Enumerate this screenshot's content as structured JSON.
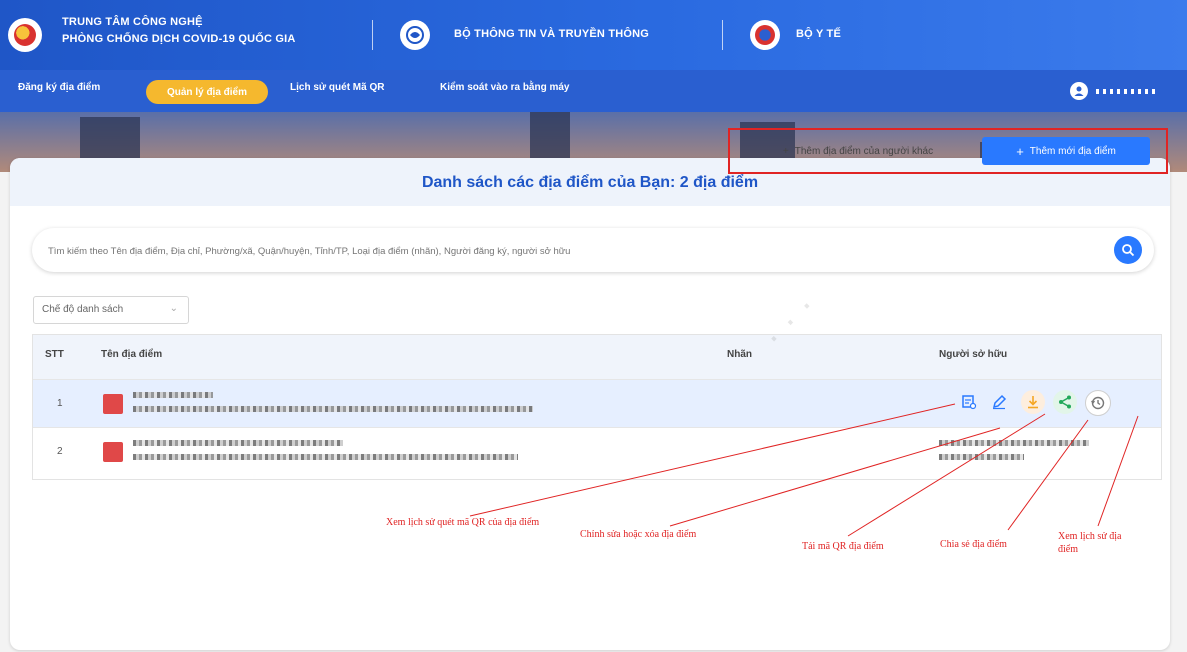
{
  "header": {
    "org_line1": "TRUNG TÂM CÔNG NGHỆ",
    "org_line2": "PHÒNG CHỐNG DỊCH COVID-19 QUỐC GIA",
    "ministry1": "BỘ THÔNG TIN VÀ TRUYỀN THÔNG",
    "ministry2": "BỘ Y TẾ"
  },
  "nav": {
    "items": [
      "Đăng ký địa điểm",
      "Quản lý địa điểm",
      "Lịch sử quét Mã QR",
      "Kiểm soát vào ra bằng máy"
    ],
    "active_index": 1
  },
  "main": {
    "title": "Danh sách các địa điểm của Bạn: 2 địa điểm",
    "search_placeholder": "Tìm kiếm theo Tên địa điểm, Địa chỉ, Phường/xã, Quận/huyện, Tỉnh/TP, Loại địa điểm (nhãn), Người đăng ký, người sở hữu",
    "view_mode": "Chế độ danh sách",
    "btn_add_other": "Thêm địa điểm của người khác",
    "btn_add_new": "Thêm mới địa điểm",
    "columns": [
      "STT",
      "Tên địa điểm",
      "Nhãn",
      "Người sở hữu"
    ],
    "rows": [
      {
        "stt": "1"
      },
      {
        "stt": "2"
      }
    ]
  },
  "annotations": {
    "history_qr": "Xem lịch sử quét mã QR của địa điểm",
    "edit_delete": "Chỉnh sửa hoặc xóa địa điểm",
    "download_qr": "Tải mã QR địa điểm",
    "share": "Chia sẻ địa điểm",
    "view_history": "Xem lịch sử địa điểm"
  },
  "colors": {
    "primary": "#1f56c7",
    "accent": "#f5b82e",
    "button_blue": "#2979ff",
    "annotation_red": "#e02424"
  }
}
